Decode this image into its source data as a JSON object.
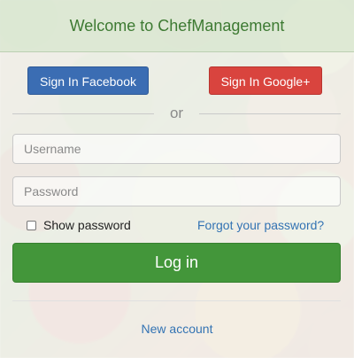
{
  "header": {
    "title": "Welcome to ChefManagement"
  },
  "social": {
    "facebook_label": "Sign In Facebook",
    "google_label": "Sign In Google+"
  },
  "separator": {
    "text": "or"
  },
  "form": {
    "username": {
      "value": "",
      "placeholder": "Username"
    },
    "password": {
      "value": "",
      "placeholder": "Password"
    },
    "show_password_label": "Show password",
    "show_password_checked": false,
    "forgot_label": "Forgot your password?",
    "login_label": "Log in"
  },
  "footer": {
    "new_account_label": "New account"
  },
  "colors": {
    "header_text": "#3d7a32",
    "facebook": "#3b6db3",
    "google": "#d9443e",
    "login": "#43963a",
    "link": "#3373b3"
  }
}
